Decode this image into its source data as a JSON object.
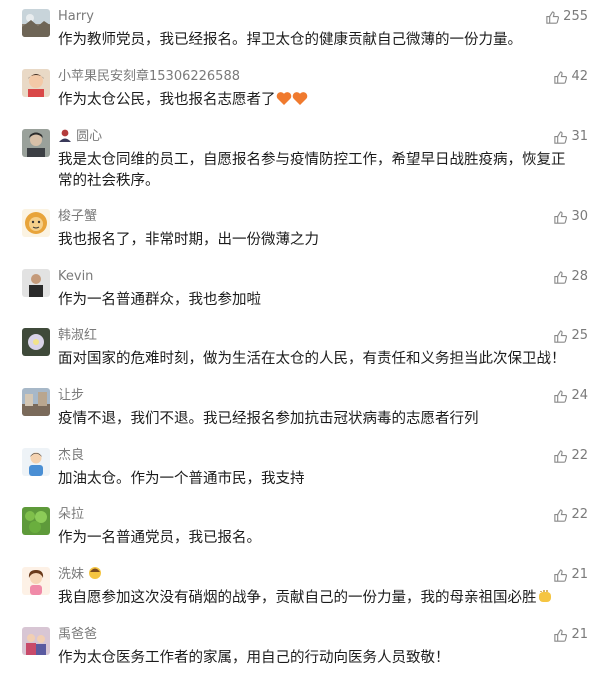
{
  "comments": [
    {
      "name": "Harry",
      "likes": "255",
      "text": "作为教师党员，我已经报名。捍卫太仓的健康贡献自己微薄的一份力量。",
      "avatar": "landscape-avatar",
      "emoji": ""
    },
    {
      "name": "小苹果民安刻章15306226588",
      "likes": "42",
      "text": "作为太仓公民，我也报名志愿者了",
      "avatar": "child-avatar",
      "emoji": "hearts"
    },
    {
      "name": "圆心",
      "likes": "31",
      "text": "我是太仓同维的员工，自愿报名参与疫情防控工作，希望早日战胜疫病，恢复正常的社会秩序。",
      "avatar": "person-photo-avatar",
      "emoji": ""
    },
    {
      "name": "梭子蟹",
      "likes": "30",
      "text": "我也报名了，非常时期，出一份微薄之力",
      "avatar": "lion-avatar",
      "emoji": ""
    },
    {
      "name": "Kevin",
      "likes": "28",
      "text": "作为一名普通群众，我也参加啦",
      "avatar": "man-photo-avatar",
      "emoji": ""
    },
    {
      "name": "韩淑红",
      "likes": "25",
      "text": "面对国家的危难时刻，做为生活在太仓的人民，有责任和义务担当此次保卫战！",
      "avatar": "flower-avatar",
      "emoji": ""
    },
    {
      "name": "让步",
      "likes": "24",
      "text": "疫情不退，我们不退。我已经报名参加抗击冠状病毒的志愿者行列",
      "avatar": "street-avatar",
      "emoji": ""
    },
    {
      "name": "杰良",
      "likes": "22",
      "text": "加油太仓。作为一个普通市民，我支持",
      "avatar": "cartoon-person-avatar",
      "emoji": ""
    },
    {
      "name": "朵拉",
      "likes": "22",
      "text": "作为一名普通党员，我已报名。",
      "avatar": "green-leaves-avatar",
      "emoji": ""
    },
    {
      "name": "洗妹",
      "likes": "21",
      "text": "我自愿参加这次没有硝烟的战争，贡献自己的一份力量，我的母亲祖国必胜",
      "avatar": "cartoon-girl-avatar",
      "emoji": "fist"
    },
    {
      "name": "禹爸爸",
      "likes": "21",
      "text": "作为太仓医务工作者的家属，用自己的行动向医务人员致敬！",
      "avatar": "family-avatar",
      "emoji": ""
    }
  ]
}
